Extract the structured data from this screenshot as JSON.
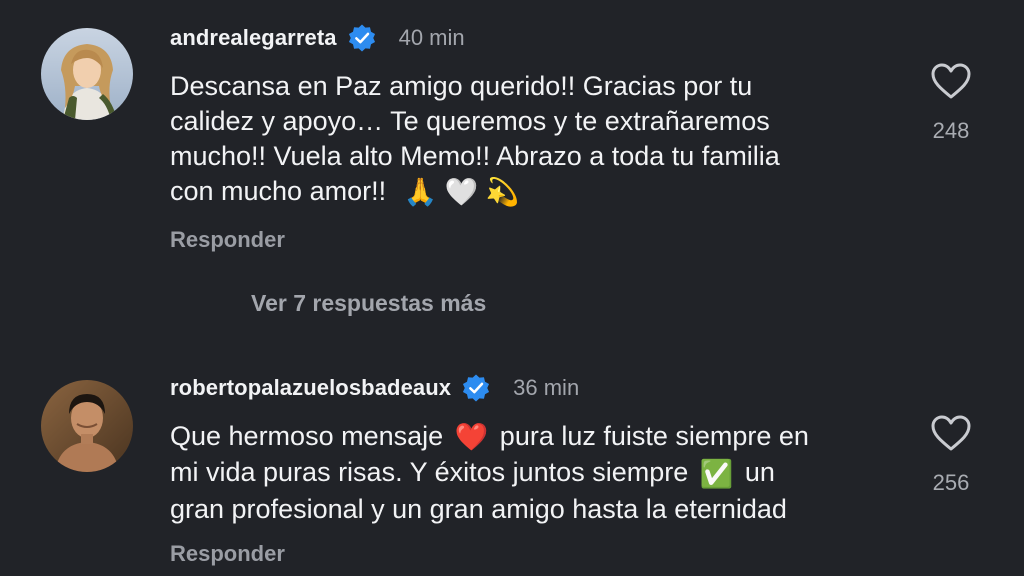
{
  "comments": [
    {
      "username": "andrealegarreta",
      "time": "40 min",
      "lines": [
        "Descansa en Paz amigo querido!! Gracias por tu",
        "calidez y apoyo… Te queremos y te extrañaremos",
        "mucho!! Vuela alto Memo!! Abrazo a toda tu familia",
        "con mucho amor!!"
      ],
      "emojis": [
        "🙏",
        "🤍",
        "💫"
      ],
      "reply_label": "Responder",
      "likes": "248",
      "verified": true,
      "avatar_icon": "avatar-woman-blonde"
    },
    {
      "username": "robertopalazuelosbadeaux",
      "time": "36 min",
      "line1_a": "Que hermoso mensaje",
      "line1_emoji": "❤️",
      "line1_b": "pura luz fuiste siempre en",
      "line2_a": "mi vida  puras risas. Y éxitos juntos  siempre",
      "line2_emoji": "✅",
      "line2_b": "un",
      "line3": "gran profesional y un gran amigo  hasta la eternidad",
      "reply_label": "Responder",
      "likes": "256",
      "verified": true,
      "avatar_icon": "avatar-man-dark-hair"
    }
  ],
  "more_replies": "Ver 7 respuestas más",
  "colors": {
    "background": "#212328",
    "verified_badge": "#2d8cf0",
    "text_primary": "#f2f3f5",
    "text_secondary": "#a3a6ad"
  }
}
